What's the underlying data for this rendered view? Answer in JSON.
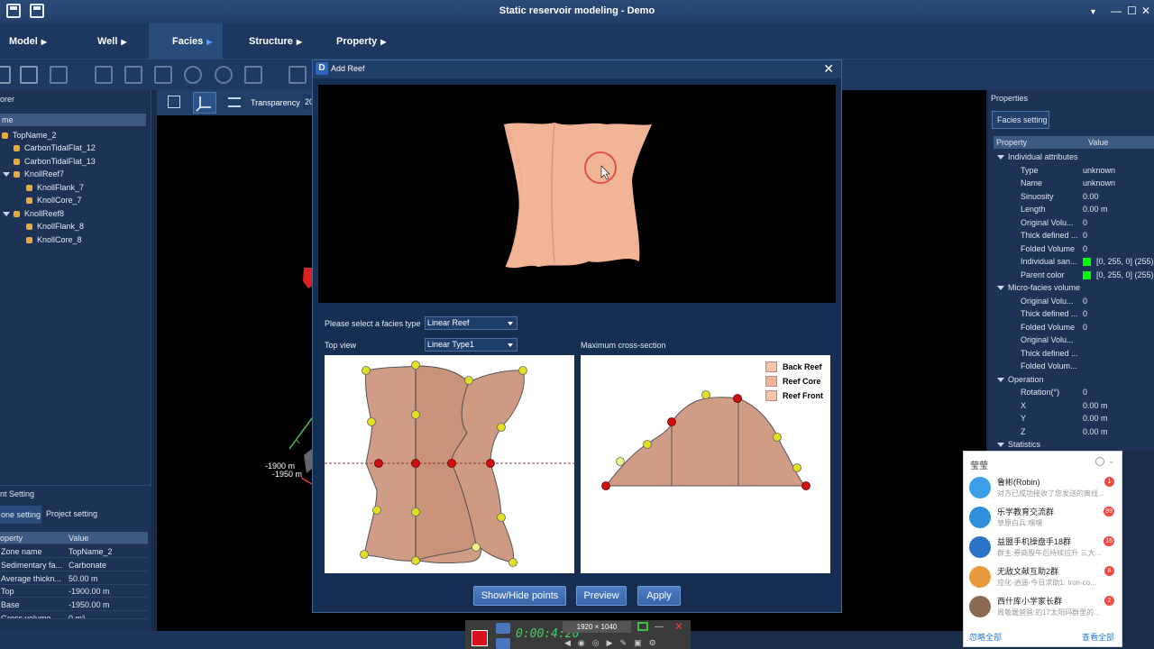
{
  "window": {
    "title": "Static reservoir modeling - Demo"
  },
  "menu": [
    {
      "label": "Model",
      "active": false
    },
    {
      "label": "Well",
      "active": false
    },
    {
      "label": "Facies",
      "active": true
    },
    {
      "label": "Structure",
      "active": false
    },
    {
      "label": "Property",
      "active": false
    }
  ],
  "explorer": {
    "title": "orer",
    "column": "me",
    "items": [
      {
        "label": "TopName_2"
      },
      {
        "label": "CarbonTidalFlat_12"
      },
      {
        "label": "CarbonTidalFlat_13"
      },
      {
        "label": "KnollReef7"
      },
      {
        "label": "KnollFlank_7"
      },
      {
        "label": "KnollCore_7"
      },
      {
        "label": "KnollReef8"
      },
      {
        "label": "KnollFlank_8"
      },
      {
        "label": "KnollCore_8"
      }
    ]
  },
  "settings": {
    "title": "nt Setting",
    "tabs": [
      "one setting",
      "Project setting"
    ],
    "headers": [
      "operty",
      "Value"
    ],
    "rows": [
      {
        "k": "Zone name",
        "v": "TopName_2"
      },
      {
        "k": "Sedimentary fa...",
        "v": "Carbonate"
      },
      {
        "k": "Average thickn...",
        "v": "50.00 m"
      },
      {
        "k": "Top",
        "v": "-1900.00 m"
      },
      {
        "k": "Base",
        "v": "-1950.00 m"
      },
      {
        "k": "Gross volume",
        "v": "0 m³"
      }
    ]
  },
  "viewport": {
    "transparency_label": "Transparency",
    "transparency_value": "20",
    "depth_label_1": "-1900 m",
    "depth_label_2": "-1950 m"
  },
  "properties": {
    "title": "Properties",
    "tab": "Facies setting",
    "headers": [
      "Property",
      "Value"
    ],
    "rows": [
      {
        "k": "Individual attributes",
        "v": "",
        "section": true
      },
      {
        "k": "Type",
        "v": "unknown"
      },
      {
        "k": "Name",
        "v": "unknown"
      },
      {
        "k": "Sinuosity",
        "v": "0.00"
      },
      {
        "k": "Length",
        "v": "0.00 m"
      },
      {
        "k": "Original Volu...",
        "v": "0"
      },
      {
        "k": "Thick defined ...",
        "v": "0"
      },
      {
        "k": "Folded Volume",
        "v": "0"
      },
      {
        "k": "Individual san...",
        "v": "[0, 255, 0] (255)",
        "swatch": "#00ff00"
      },
      {
        "k": "Parent color",
        "v": "[0, 255, 0] (255)",
        "swatch": "#00ff00"
      },
      {
        "k": "Micro-facies volume",
        "v": "",
        "section": true
      },
      {
        "k": "Original Volu...",
        "v": "0"
      },
      {
        "k": "Thick defined ...",
        "v": "0"
      },
      {
        "k": "Folded Volume",
        "v": "0"
      },
      {
        "k": "Original Volu...",
        "v": ""
      },
      {
        "k": "Thick defined ...",
        "v": ""
      },
      {
        "k": "Folded Volum...",
        "v": ""
      },
      {
        "k": "Operation",
        "v": "",
        "section": true
      },
      {
        "k": "Rotation(°)",
        "v": "0"
      },
      {
        "k": "X",
        "v": "0.00 m"
      },
      {
        "k": "Y",
        "v": "0.00 m"
      },
      {
        "k": "Z",
        "v": "0.00 m"
      },
      {
        "k": "Statistics",
        "v": "",
        "section": true
      }
    ]
  },
  "dialog": {
    "title": "Add Reef",
    "facies_type_label": "Please select a facies type",
    "facies_type_value": "Linear Reef",
    "top_view_label": "Top view",
    "top_view_value": "Linear Type1",
    "cross_section_label": "Maximum cross-section",
    "legend": [
      {
        "label": "Back Reef",
        "color": "#f4c3a8"
      },
      {
        "label": "Reef Core",
        "color": "#f1b596"
      },
      {
        "label": "Reef Front",
        "color": "#f4c3a8"
      }
    ],
    "buttons": {
      "show_hide": "Show/Hide points",
      "preview": "Preview",
      "apply": "Apply"
    }
  },
  "chat": {
    "title": "莹莹",
    "items": [
      {
        "name": "鲁彬(Robin)",
        "msg": "对方已成功接收了您发送的离线...",
        "badge": "1",
        "color": "#3b9ee8"
      },
      {
        "name": "乐学教育交流群",
        "msg": "草原白兵:嘿嘿",
        "badge": "89",
        "color": "#2f8fdc"
      },
      {
        "name": "益盟手机操盘手18群",
        "msg": "群主:券商股午后持续拉升 三大...",
        "badge": "15",
        "color": "#2a74c8"
      },
      {
        "name": "无敌文献互助2群",
        "msg": "应化-逍遥-今日求助1: Iron-co...",
        "badge": "8",
        "color": "#e99a3a"
      },
      {
        "name": "西什库小学家长群",
        "msg": "周敬媛爸爸:的17太阳玛群里的...",
        "badge": "2",
        "color": "#8a6a52"
      }
    ],
    "footer_left": "忽略全部",
    "footer_right": "查看全部"
  },
  "recorder": {
    "time": "0:00:4:20",
    "resolution": "1920 × 1040"
  }
}
